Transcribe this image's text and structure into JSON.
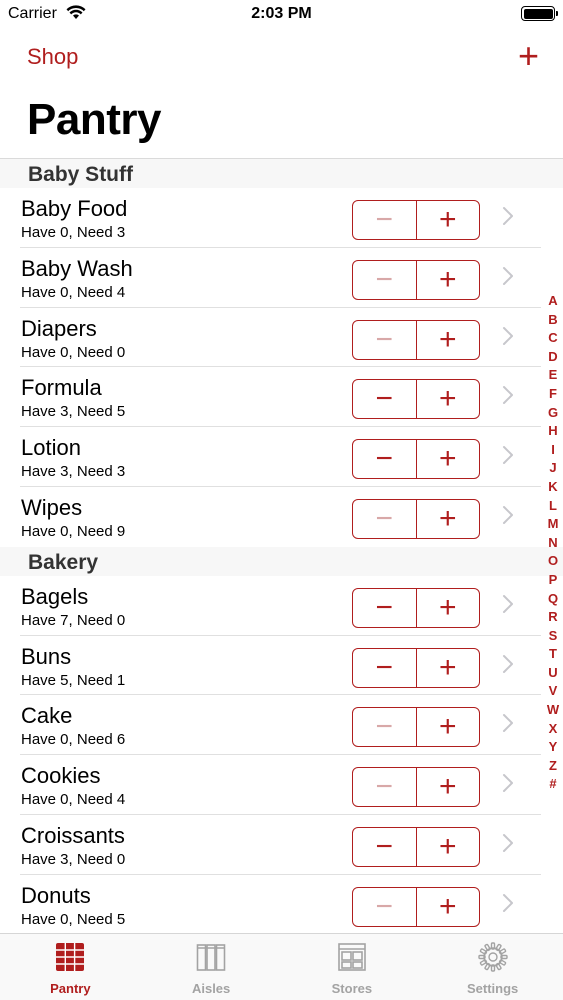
{
  "status": {
    "carrier": "Carrier",
    "time": "2:03 PM"
  },
  "nav": {
    "back_label": "Shop",
    "add_label": "+"
  },
  "title": "Pantry",
  "colors": {
    "accent": "#b01e1e",
    "disabled": "#d8a8a8",
    "section_bg": "#f7f7f7"
  },
  "sections": [
    {
      "name": "Baby Stuff",
      "items": [
        {
          "name": "Baby Food",
          "detail": "Have 0, Need 3",
          "have": 0
        },
        {
          "name": "Baby Wash",
          "detail": "Have 0, Need 4",
          "have": 0
        },
        {
          "name": "Diapers",
          "detail": "Have 0, Need 0",
          "have": 0
        },
        {
          "name": "Formula",
          "detail": "Have 3, Need 5",
          "have": 3
        },
        {
          "name": "Lotion",
          "detail": "Have 3, Need 3",
          "have": 3
        },
        {
          "name": "Wipes",
          "detail": "Have 0, Need 9",
          "have": 0
        }
      ]
    },
    {
      "name": "Bakery",
      "items": [
        {
          "name": "Bagels",
          "detail": "Have 7, Need 0",
          "have": 7
        },
        {
          "name": "Buns",
          "detail": "Have 5, Need 1",
          "have": 5
        },
        {
          "name": "Cake",
          "detail": "Have 0, Need 6",
          "have": 0
        },
        {
          "name": "Cookies",
          "detail": "Have 0, Need 4",
          "have": 0
        },
        {
          "name": "Croissants",
          "detail": "Have 3, Need 0",
          "have": 3
        },
        {
          "name": "Donuts",
          "detail": "Have 0, Need 5",
          "have": 0
        }
      ]
    }
  ],
  "stepper": {
    "minus": "−",
    "plus": "+"
  },
  "index_letters": [
    "A",
    "B",
    "C",
    "D",
    "E",
    "F",
    "G",
    "H",
    "I",
    "J",
    "K",
    "L",
    "M",
    "N",
    "O",
    "P",
    "Q",
    "R",
    "S",
    "T",
    "U",
    "V",
    "W",
    "X",
    "Y",
    "Z",
    "#"
  ],
  "tabs": [
    {
      "label": "Pantry",
      "icon": "grid-icon",
      "active": true
    },
    {
      "label": "Aisles",
      "icon": "aisles-icon",
      "active": false
    },
    {
      "label": "Stores",
      "icon": "stores-icon",
      "active": false
    },
    {
      "label": "Settings",
      "icon": "gear-icon",
      "active": false
    }
  ]
}
